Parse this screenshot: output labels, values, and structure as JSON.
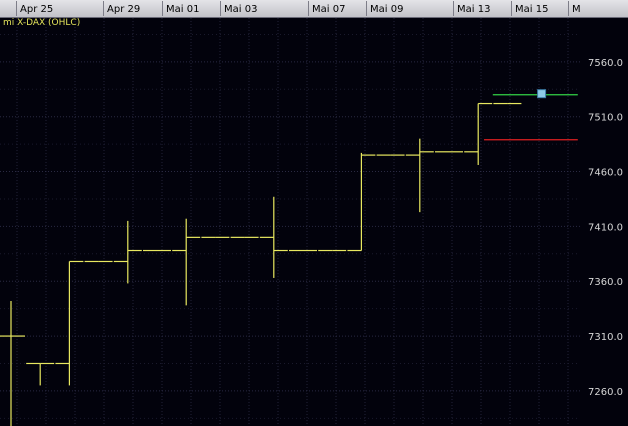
{
  "chart_data": {
    "type": "ohlc",
    "series_name": "mi X-DAX (OHLC)",
    "x_ticks": [
      "Apr 25",
      "Apr 29",
      "Mai 01",
      "Mai 03",
      "Mai 07",
      "Mai 09",
      "Mai 13",
      "Mai 15",
      "M"
    ],
    "y_ticks": [
      "7560.0",
      "7510.0",
      "7460.0",
      "7410.0",
      "7360.0",
      "7310.0",
      "7260.0"
    ],
    "ylim": [
      7228,
      7600
    ],
    "grid": true,
    "bars": [
      {
        "open": 7310,
        "high": 7342,
        "low": 7225,
        "close": 7310
      },
      {
        "open": 7285,
        "high": 7285,
        "low": 7265,
        "close": 7285
      },
      {
        "open": 7285,
        "high": 7378,
        "low": 7265,
        "close": 7378
      },
      {
        "open": 7378,
        "high": 7378,
        "low": 7378,
        "close": 7378
      },
      {
        "open": 7378,
        "high": 7415,
        "low": 7358,
        "close": 7388
      },
      {
        "open": 7388,
        "high": 7388,
        "low": 7388,
        "close": 7388
      },
      {
        "open": 7388,
        "high": 7417,
        "low": 7338,
        "close": 7400
      },
      {
        "open": 7400,
        "high": 7400,
        "low": 7400,
        "close": 7400
      },
      {
        "open": 7400,
        "high": 7400,
        "low": 7400,
        "close": 7400
      },
      {
        "open": 7400,
        "high": 7437,
        "low": 7363,
        "close": 7388
      },
      {
        "open": 7388,
        "high": 7388,
        "low": 7388,
        "close": 7388
      },
      {
        "open": 7388,
        "high": 7388,
        "low": 7388,
        "close": 7388
      },
      {
        "open": 7388,
        "high": 7477,
        "low": 7388,
        "close": 7475
      },
      {
        "open": 7475,
        "high": 7475,
        "low": 7475,
        "close": 7475
      },
      {
        "open": 7475,
        "high": 7490,
        "low": 7423,
        "close": 7478
      },
      {
        "open": 7478,
        "high": 7478,
        "low": 7478,
        "close": 7478
      },
      {
        "open": 7478,
        "high": 7522,
        "low": 7466,
        "close": 7522
      },
      {
        "open": 7522,
        "high": 7522,
        "low": 7522,
        "close": 7522
      }
    ],
    "levels": [
      {
        "value": 7530,
        "color": "#32d246",
        "from_bar": 16.5,
        "to_bar": 19
      },
      {
        "value": 7489,
        "color": "#e02020",
        "from_bar": 16.2,
        "to_bar": 19
      }
    ],
    "marker": {
      "value": 7531,
      "color": "#8ecbe6",
      "at_bar": 18
    }
  }
}
